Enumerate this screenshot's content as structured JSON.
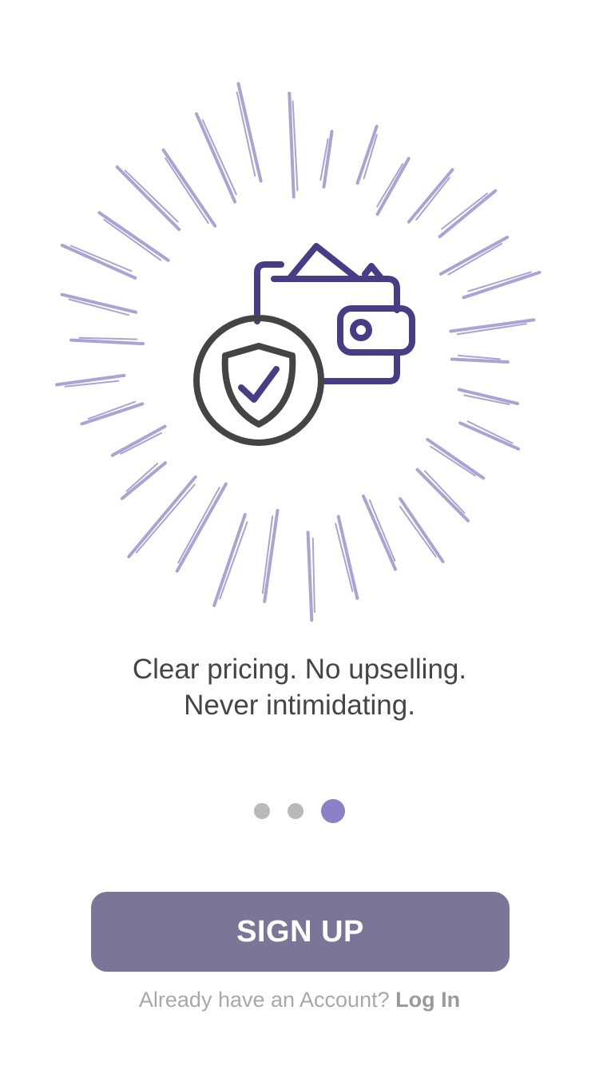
{
  "onboarding": {
    "tagline_line1": "Clear pricing. No upselling.",
    "tagline_line2": "Never intimidating.",
    "pages_total": 3,
    "current_page": 3,
    "illustration_icons": [
      "wallet-icon",
      "shield-check-icon"
    ]
  },
  "actions": {
    "signup_label": "SIGN UP",
    "login_prompt": "Already have an Account?",
    "login_link": "Log In"
  },
  "colors": {
    "accent_purple": "#8c80c6",
    "rays": "#aaa3d4",
    "wallet_stroke": "#473c86",
    "shield_stroke": "#444444",
    "button_bg": "#7b7697",
    "dot_inactive": "#b9b9b9",
    "text_dark": "#454545",
    "text_muted": "#a8a8a8"
  }
}
